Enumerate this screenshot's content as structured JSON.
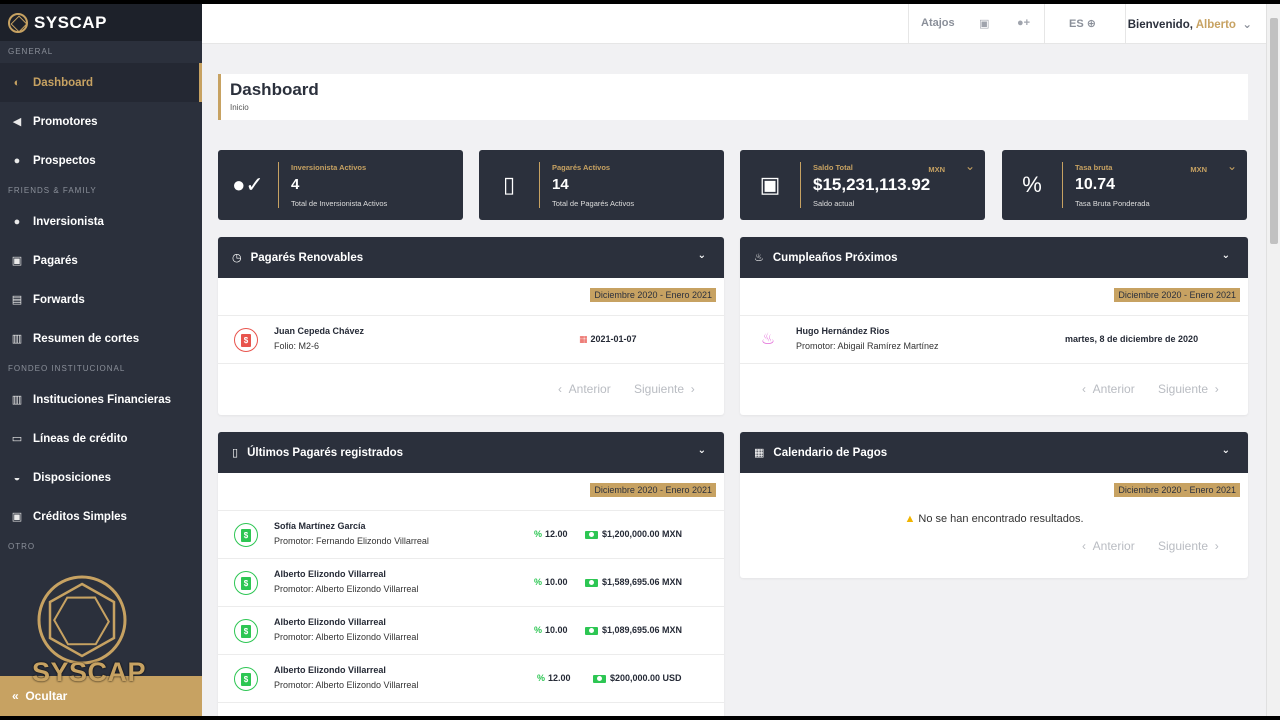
{
  "brand": {
    "name": "SYSCAP",
    "watermark_text": "SYSCAP"
  },
  "colors": {
    "accent": "#c7a262",
    "sidebar": "#2b303c",
    "positive": "#2dc653",
    "danger": "#e8544d"
  },
  "sidebar": {
    "sections": [
      {
        "label": "GENERAL",
        "items": [
          {
            "label": "Dashboard",
            "icon": "dashboard-icon",
            "active": true
          },
          {
            "label": "Promotores",
            "icon": "megaphone-icon"
          },
          {
            "label": "Prospectos",
            "icon": "users-icon"
          }
        ]
      },
      {
        "label": "FRIENDS & FAMILY",
        "items": [
          {
            "label": "Inversionista",
            "icon": "user-icon"
          },
          {
            "label": "Pagarés",
            "icon": "money-icon"
          },
          {
            "label": "Forwards",
            "icon": "card-icon"
          },
          {
            "label": "Resumen de cortes",
            "icon": "bar-chart-icon"
          }
        ]
      },
      {
        "label": "FONDEO INSTITUCIONAL",
        "items": [
          {
            "label": "Instituciones Financieras",
            "icon": "bank-icon"
          },
          {
            "label": "Líneas de crédito",
            "icon": "credit-card-icon"
          },
          {
            "label": "Disposiciones",
            "icon": "hand-icon"
          },
          {
            "label": "Créditos Simples",
            "icon": "cash-icon"
          }
        ]
      },
      {
        "label": "OTRO",
        "items": []
      }
    ],
    "footer_label": "Ocultar"
  },
  "topbar": {
    "shortcuts": "Atajos",
    "language": "ES",
    "welcome": "Bienvenido,",
    "user": "Alberto"
  },
  "page": {
    "title": "Dashboard",
    "breadcrumb": "Inicio"
  },
  "stats": [
    {
      "label": "Inversionista Activos",
      "value": "4",
      "sub": "Total de Inversionista Activos",
      "icon": "user-check-icon",
      "currency": ""
    },
    {
      "label": "Pagarés Activos",
      "value": "14",
      "sub": "Total de Pagarés Activos",
      "icon": "invoice-icon",
      "currency": ""
    },
    {
      "label": "Saldo Total",
      "value": "$15,231,113.92",
      "sub": "Saldo actual",
      "icon": "bill-icon",
      "currency": "MXN"
    },
    {
      "label": "Tasa bruta",
      "value": "10.74",
      "sub": "Tasa Bruta Ponderada",
      "icon": "percent-icon",
      "currency": "MXN"
    }
  ],
  "panels": {
    "renovables": {
      "title": "Pagarés Renovables",
      "range": "Diciembre 2020 - Enero 2021",
      "rows": [
        {
          "name": "Juan Cepeda Chávez",
          "sub": "Folio: M2-6",
          "date": "2021-01-07"
        }
      ],
      "prev": "Anterior",
      "next": "Siguiente"
    },
    "cumpleanos": {
      "title": "Cumpleaños Próximos",
      "range": "Diciembre 2020 - Enero 2021",
      "rows": [
        {
          "name": "Hugo Hernández Rios",
          "sub": "Promotor: Abigail Ramírez Martínez",
          "date": "martes, 8 de diciembre de 2020"
        }
      ],
      "prev": "Anterior",
      "next": "Siguiente"
    },
    "ultimos": {
      "title": "Últimos Pagarés registrados",
      "range": "Diciembre 2020 - Enero 2021",
      "rows": [
        {
          "name": "Sofía Martínez García",
          "sub": "Promotor: Fernando Elizondo Villarreal",
          "rate": "12.00",
          "amount": "$1,200,000.00 MXN"
        },
        {
          "name": "Alberto Elizondo Villarreal",
          "sub": "Promotor: Alberto Elizondo Villarreal",
          "rate": "10.00",
          "amount": "$1,589,695.06 MXN"
        },
        {
          "name": "Alberto Elizondo Villarreal",
          "sub": "Promotor: Alberto Elizondo Villarreal",
          "rate": "10.00",
          "amount": "$1,089,695.06 MXN"
        },
        {
          "name": "Alberto Elizondo Villarreal",
          "sub": "Promotor: Alberto Elizondo Villarreal",
          "rate": "12.00",
          "amount": "$200,000.00 USD"
        }
      ]
    },
    "calendario": {
      "title": "Calendario de Pagos",
      "range": "Diciembre 2020 - Enero 2021",
      "empty": "No se han encontrado resultados.",
      "prev": "Anterior",
      "next": "Siguiente"
    }
  }
}
